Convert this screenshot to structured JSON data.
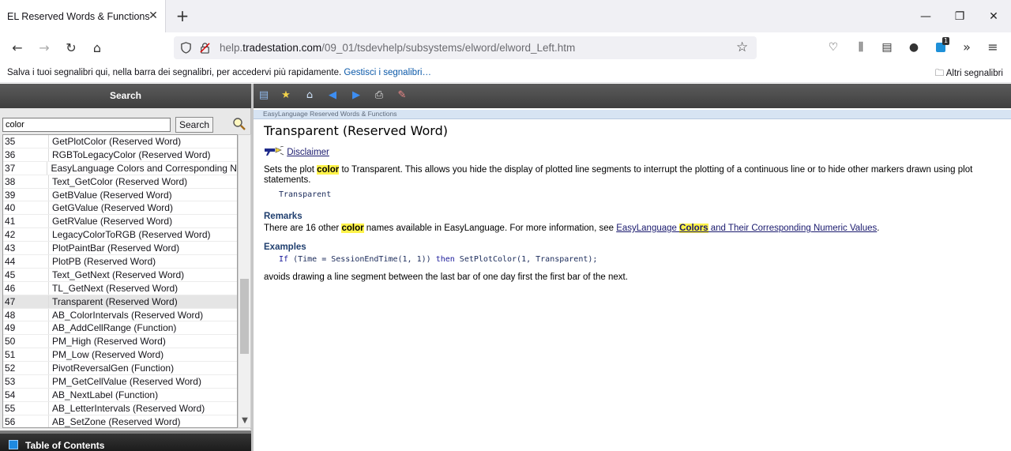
{
  "browser": {
    "tab_title": "EL Reserved Words & Functions",
    "url_prefix": "help.",
    "url_domain": "tradestation.com",
    "url_path": "/09_01/tsdevhelp/subsystems/elword/elword_Left.htm",
    "extension_badge": "1"
  },
  "bookmarks": {
    "message": "Salva i tuoi segnalibri qui, nella barra dei segnalibri, per accedervi più rapidamente.",
    "manage_link": "Gestisci i segnalibri…",
    "other": "Altri segnalibri"
  },
  "left": {
    "header": "Search",
    "search_value": "color",
    "search_button": "Search",
    "footer": "Table of Contents",
    "results": [
      {
        "num": "35",
        "name": "GetPlotColor (Reserved Word)"
      },
      {
        "num": "36",
        "name": "RGBToLegacyColor (Reserved Word)"
      },
      {
        "num": "37",
        "name": "EasyLanguage Colors and Corresponding Nu"
      },
      {
        "num": "38",
        "name": "Text_GetColor (Reserved Word)"
      },
      {
        "num": "39",
        "name": "GetBValue (Reserved Word)"
      },
      {
        "num": "40",
        "name": "GetGValue (Reserved Word)"
      },
      {
        "num": "41",
        "name": "GetRValue (Reserved Word)"
      },
      {
        "num": "42",
        "name": "LegacyColorToRGB (Reserved Word)"
      },
      {
        "num": "43",
        "name": "PlotPaintBar (Reserved Word)"
      },
      {
        "num": "44",
        "name": "PlotPB (Reserved Word)"
      },
      {
        "num": "45",
        "name": "Text_GetNext (Reserved Word)"
      },
      {
        "num": "46",
        "name": "TL_GetNext (Reserved Word)"
      },
      {
        "num": "47",
        "name": "Transparent (Reserved Word)"
      },
      {
        "num": "48",
        "name": "AB_ColorIntervals (Reserved Word)"
      },
      {
        "num": "49",
        "name": "AB_AddCellRange (Function)"
      },
      {
        "num": "50",
        "name": "PM_High (Reserved Word)"
      },
      {
        "num": "51",
        "name": "PM_Low (Reserved Word)"
      },
      {
        "num": "52",
        "name": "PivotReversalGen (Function)"
      },
      {
        "num": "53",
        "name": "PM_GetCellValue (Reserved Word)"
      },
      {
        "num": "54",
        "name": "AB_NextLabel (Function)"
      },
      {
        "num": "55",
        "name": "AB_LetterIntervals (Reserved Word)"
      },
      {
        "num": "56",
        "name": "AB_SetZone (Reserved Word)"
      }
    ],
    "selected_index": 12
  },
  "topic": {
    "breadcrumb": "EasyLanguage Reserved Words & Functions",
    "title": "Transparent (Reserved Word)",
    "disclaimer": "Disclaimer",
    "desc_before": "Sets the plot ",
    "desc_hl": "color",
    "desc_after": " to Transparent. This allows you hide the display of plotted line segments to interrupt the plotting of a continuous line or to hide other markers drawn using plot statements.",
    "syntax": "Transparent",
    "remarks_heading": "Remarks",
    "remarks_before": "There are 16 other ",
    "remarks_hl": "color",
    "remarks_mid": " names available in EasyLanguage. For more information, see ",
    "remarks_link_a": "EasyLanguage ",
    "remarks_link_hl": "Colors",
    "remarks_link_b": " and Their Corresponding Numeric Values",
    "remarks_end": ".",
    "examples_heading": "Examples",
    "example_if": "If",
    "example_cond": " (Time = SessionEndTime(1, 1)) ",
    "example_then": "then",
    "example_call": " SetPlotColor(1, Transparent);",
    "example_note": "avoids drawing a line segment between the last bar of one day first the first bar of the next."
  }
}
